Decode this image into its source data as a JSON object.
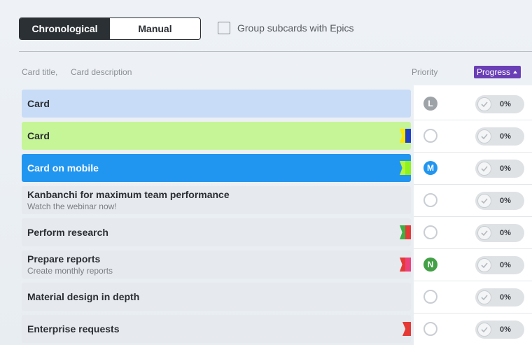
{
  "view_toggle": {
    "chronological": "Chronological",
    "manual": "Manual"
  },
  "group_subcards": "Group subcards with Epics",
  "headers": {
    "card_title": "Card title,",
    "card_description": "Card description",
    "priority": "Priority",
    "progress": "Progress"
  },
  "cards": [
    {
      "title": "Card",
      "description": "",
      "color": "#c8dcf7",
      "priority": "L",
      "progress": "0%"
    },
    {
      "title": "Card",
      "description": "",
      "color": "#c6f598",
      "priority": "",
      "progress": "0%"
    },
    {
      "title": "Card on mobile",
      "description": "",
      "color": "#2196f0",
      "priority": "M",
      "progress": "0%"
    },
    {
      "title": "Kanbanchi for maximum team performance",
      "description": "Watch the webinar now!",
      "color": "#e6e9ee",
      "priority": "",
      "progress": "0%"
    },
    {
      "title": "Perform research",
      "description": "",
      "color": "#e6e9ee",
      "priority": "",
      "progress": "0%"
    },
    {
      "title": "Prepare reports",
      "description": "Create monthly reports",
      "color": "#e6e9ee",
      "priority": "N",
      "progress": "0%"
    },
    {
      "title": "Material design in depth",
      "description": "",
      "color": "#e6e9ee",
      "priority": "",
      "progress": "0%"
    },
    {
      "title": "Enterprise requests",
      "description": "",
      "color": "#e6e9ee",
      "priority": "",
      "progress": "0%"
    }
  ],
  "colors": {
    "accent_purple": "#6a3fb5",
    "toggle_active": "#2b3034"
  }
}
